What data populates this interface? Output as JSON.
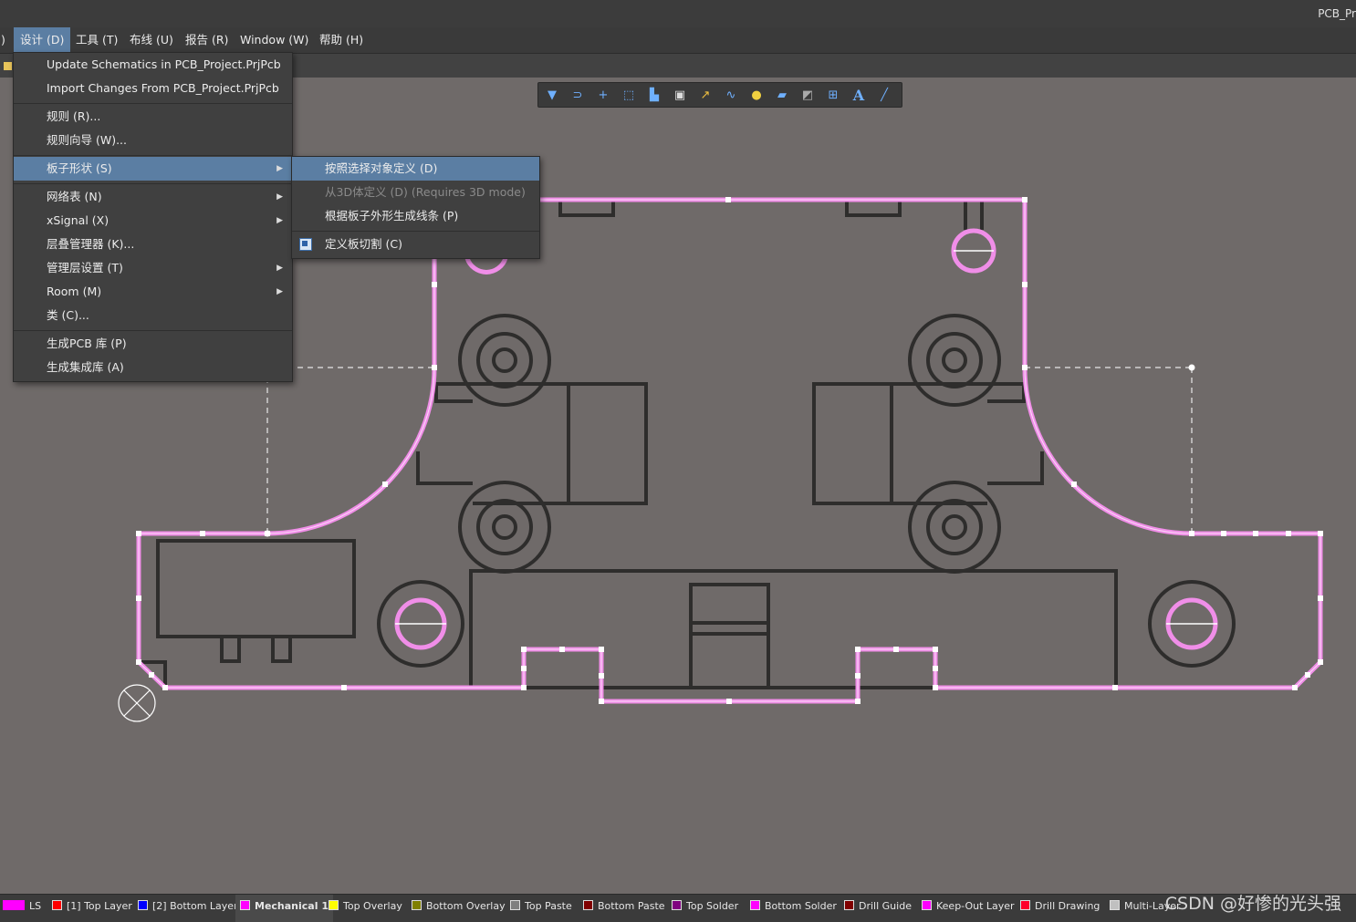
{
  "window": {
    "title": "PCB_Pr"
  },
  "menubar": {
    "items": [
      {
        "label": ")"
      },
      {
        "label": "设计 (D)"
      },
      {
        "label": "工具 (T)"
      },
      {
        "label": "布线 (U)"
      },
      {
        "label": "报告 (R)"
      },
      {
        "label": "Window (W)"
      },
      {
        "label": "帮助 (H)"
      }
    ]
  },
  "design_menu": {
    "items": [
      {
        "label": "Update Schematics in PCB_Project.PrjPcb"
      },
      {
        "label": "Import Changes From PCB_Project.PrjPcb"
      },
      {
        "label": "规则 (R)..."
      },
      {
        "label": "规则向导 (W)..."
      },
      {
        "label": "板子形状 (S)",
        "submenu_arrow": "▶"
      },
      {
        "label": "网络表 (N)",
        "submenu_arrow": "▶"
      },
      {
        "label": "xSignal (X)",
        "submenu_arrow": "▶"
      },
      {
        "label": "层叠管理器 (K)..."
      },
      {
        "label": "管理层设置 (T)",
        "submenu_arrow": "▶"
      },
      {
        "label": "Room (M)",
        "submenu_arrow": "▶"
      },
      {
        "label": "类 (C)..."
      },
      {
        "label": "生成PCB 库 (P)"
      },
      {
        "label": "生成集成库 (A)"
      }
    ]
  },
  "board_shape_submenu": {
    "items": [
      {
        "label": "按照选择对象定义 (D)"
      },
      {
        "label": "从3D体定义 (D) (Requires 3D mode)"
      },
      {
        "label": "根据板子外形生成线条 (P)"
      },
      {
        "label": "定义板切割 (C)",
        "icon": "board-cutout-icon"
      }
    ]
  },
  "toolbar": {
    "icons": [
      "filter-icon",
      "route-icon",
      "cross-icon",
      "select-rect-icon",
      "align-icon",
      "component-icon",
      "interactive-route-icon",
      "diff-pair-icon",
      "pad-icon",
      "polygon-icon",
      "region-icon",
      "dimension-icon",
      "text-icon",
      "line-icon"
    ],
    "text_button_label": "A"
  },
  "layers": [
    {
      "label": "LS",
      "color": "#ff00ff"
    },
    {
      "label": "[1] Top Layer",
      "color": "#ff0000"
    },
    {
      "label": "[2] Bottom Layer",
      "color": "#0000ff"
    },
    {
      "label": "Mechanical 1",
      "color": "#ff00ff"
    },
    {
      "label": "Top Overlay",
      "color": "#ffff00"
    },
    {
      "label": "Bottom Overlay",
      "color": "#808000"
    },
    {
      "label": "Top Paste",
      "color": "#808080"
    },
    {
      "label": "Bottom Paste",
      "color": "#800000"
    },
    {
      "label": "Top Solder",
      "color": "#800080"
    },
    {
      "label": "Bottom Solder",
      "color": "#ff00ff"
    },
    {
      "label": "Drill Guide",
      "color": "#800000"
    },
    {
      "label": "Keep-Out Layer",
      "color": "#ff00ff"
    },
    {
      "label": "Drill Drawing",
      "color": "#ff002a"
    },
    {
      "label": "Multi-Layer",
      "color": "#c0c0c0"
    }
  ],
  "watermark": "CSDN @好惨的光头强"
}
